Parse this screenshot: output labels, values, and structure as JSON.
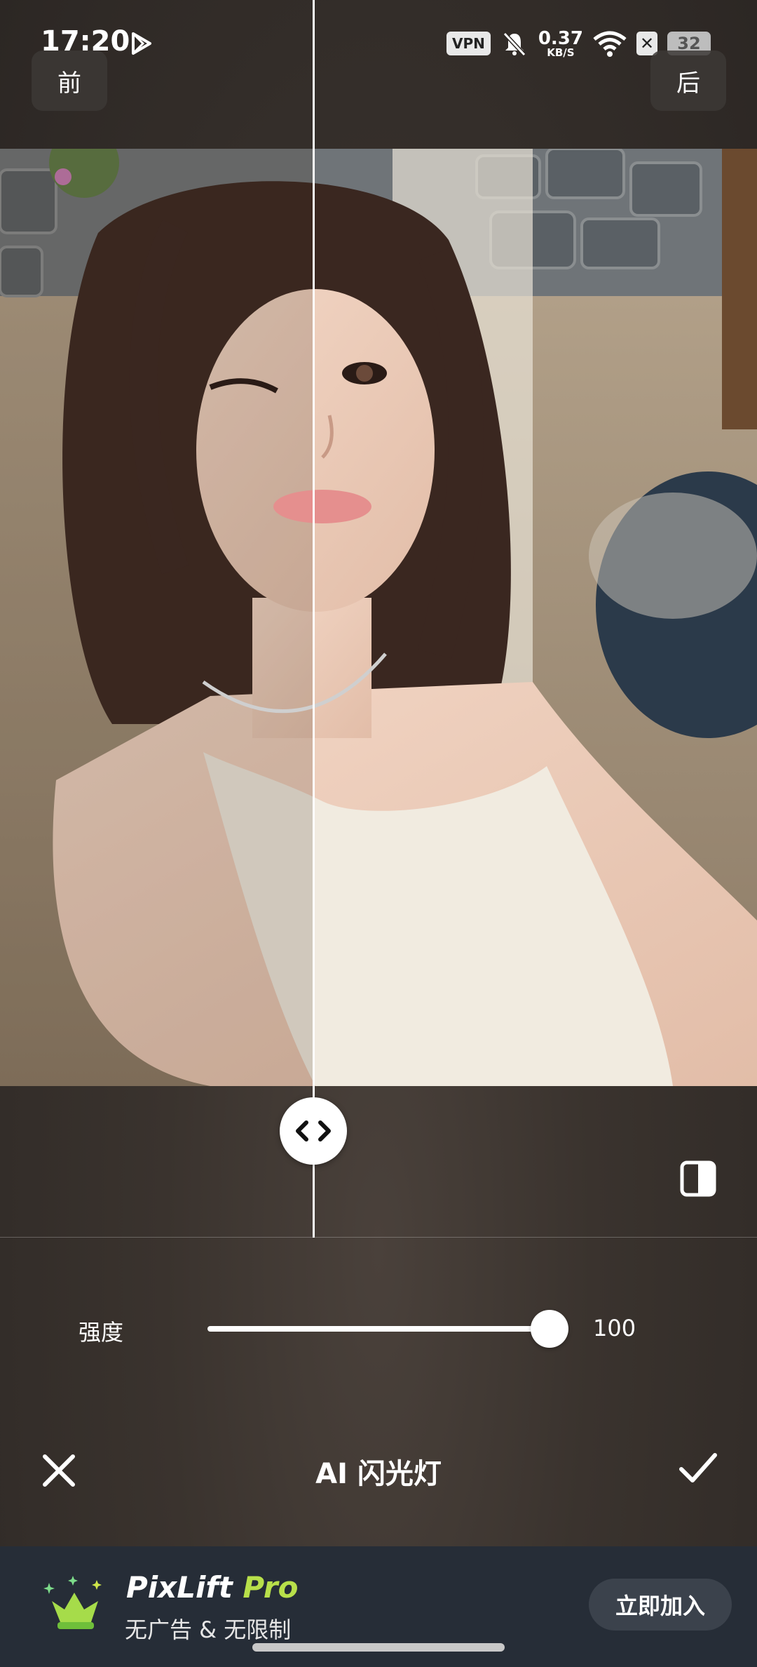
{
  "status_bar": {
    "time": "17:20",
    "vpn": "VPN",
    "speed_value": "0.37",
    "speed_unit": "KB/S",
    "battery": "32"
  },
  "compare": {
    "before_label": "前",
    "after_label": "后",
    "split_position": 0.413
  },
  "adjust": {
    "label": "强度",
    "value": "100",
    "fraction": 1.0
  },
  "toolbar": {
    "title": "AI 闪光灯"
  },
  "promo": {
    "brand": "PixLift",
    "brand_pro": "Pro",
    "subtitle": "无广告 & 无限制",
    "join_label": "立即加入"
  },
  "colors": {
    "background": "#3a332e",
    "promo_bg": "#262d37",
    "pro_accent": "#b8e04a"
  }
}
